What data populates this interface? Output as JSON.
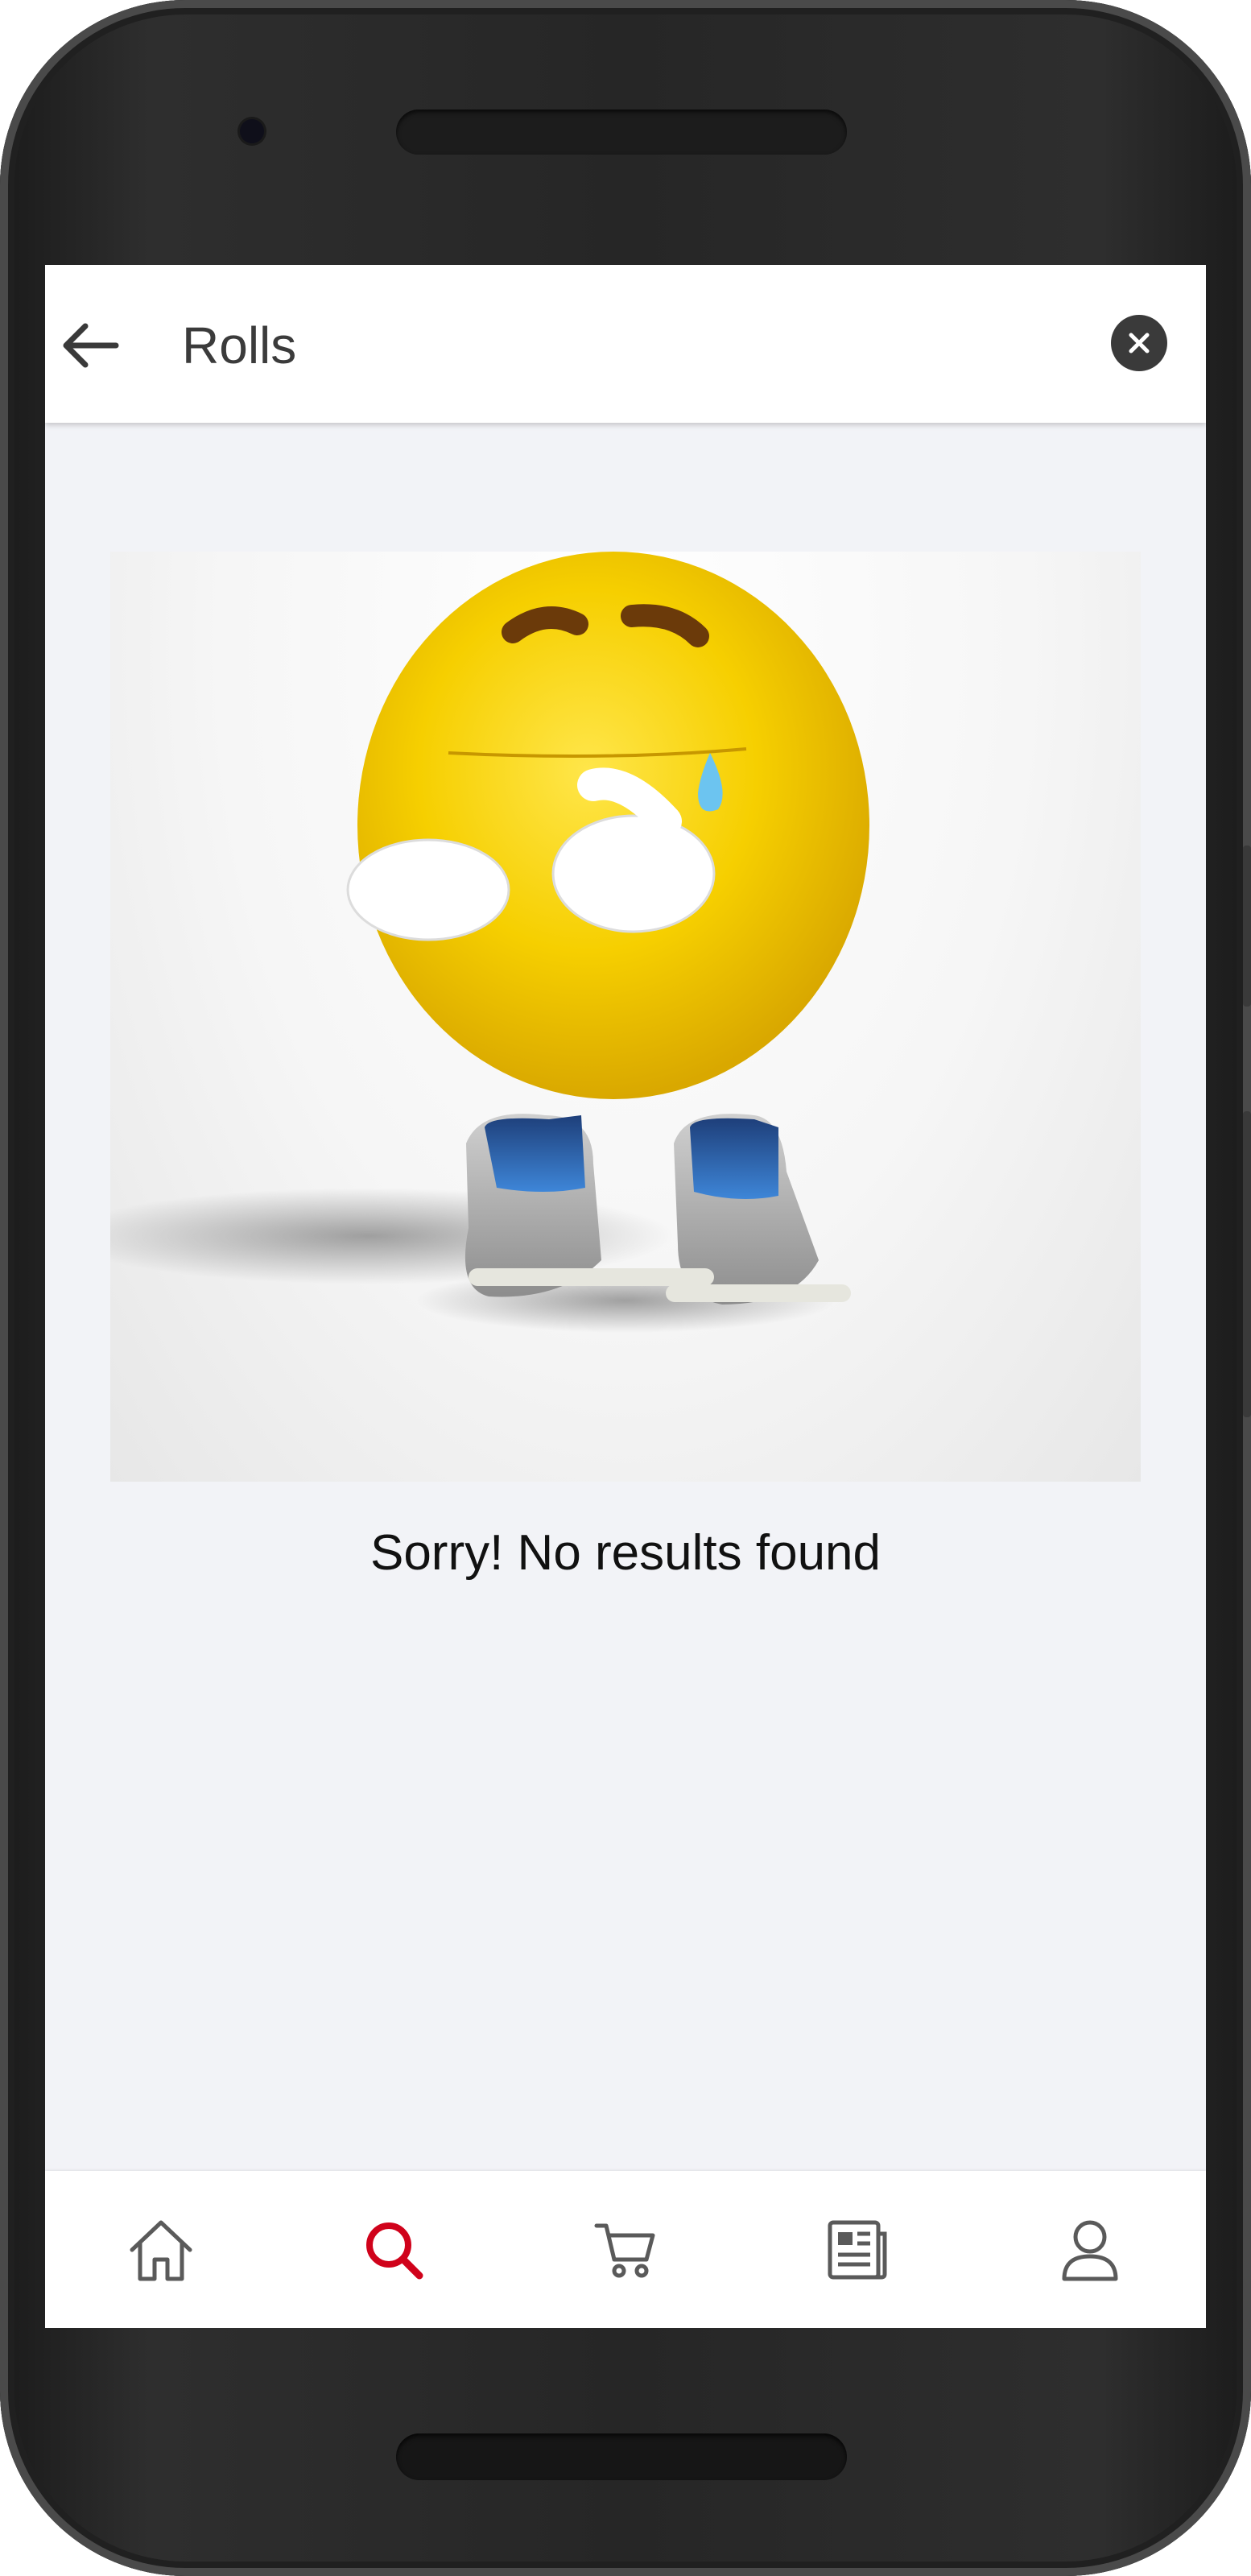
{
  "header": {
    "title": "Rolls",
    "back_icon": "arrow-left-icon",
    "clear_icon": "close-circle-icon"
  },
  "empty_state": {
    "illustration": "sad-emoji-with-shoes-illustration",
    "message": "Sorry! No results found"
  },
  "bottom_nav": {
    "items": [
      {
        "icon": "home-icon",
        "active": false
      },
      {
        "icon": "search-icon",
        "active": true
      },
      {
        "icon": "cart-icon",
        "active": false
      },
      {
        "icon": "news-icon",
        "active": false
      },
      {
        "icon": "profile-icon",
        "active": false
      }
    ]
  },
  "colors": {
    "accent": "#d0021b",
    "icon_default": "#5a5a5a",
    "screen_background": "#f2f3f7",
    "bar_background": "#ffffff"
  }
}
